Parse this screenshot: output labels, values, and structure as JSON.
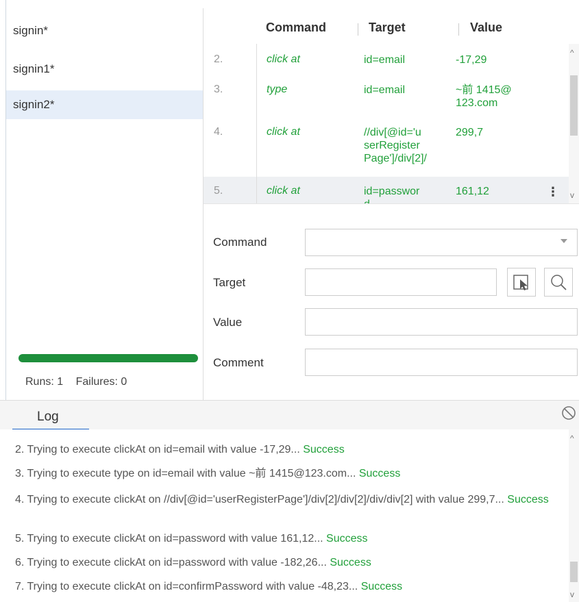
{
  "sidebar": {
    "suites": [
      {
        "label": "signin*"
      },
      {
        "label": "signin1*"
      },
      {
        "label": "signin2*"
      }
    ],
    "progress_fraction": 1.0,
    "runs_label": "Runs: 1",
    "failures_label": "Failures: 0"
  },
  "commands": {
    "headers": {
      "command": "Command",
      "target": "Target",
      "value": "Value"
    },
    "rows": [
      {
        "num": "2.",
        "command": "click at",
        "target": "id=email",
        "value": "-17,29"
      },
      {
        "num": "3.",
        "command": "type",
        "target": "id=email",
        "value": "~前 1415@\n123.com"
      },
      {
        "num": "4.",
        "command": "click at",
        "target": "//div[@id='u\nserRegister\nPage']/div[2]/",
        "value": "299,7"
      },
      {
        "num": "5.",
        "command": "click at",
        "target": "id=passwor\nd",
        "value": "161,12"
      }
    ]
  },
  "editor": {
    "command_label": "Command",
    "target_label": "Target",
    "value_label": "Value",
    "comment_label": "Comment",
    "command_value": "",
    "target_value": "",
    "value_value": "",
    "comment_value": ""
  },
  "log": {
    "tab_label": "Log",
    "lines": [
      {
        "num": "2.",
        "text": " Trying to execute clickAt on id=email with value -17,29... ",
        "status": "Success"
      },
      {
        "num": "3.",
        "text": " Trying to execute type on id=email with value ~前 1415@123.com... ",
        "status": "Success"
      },
      {
        "num": "4.",
        "text": " Trying to execute clickAt on //div[@id='userRegisterPage']/div[2]/div[2]/div/div[2] with value 299,7... ",
        "status": "Success"
      },
      {
        "num": "5.",
        "text": " Trying to execute clickAt on id=password with value 161,12... ",
        "status": "Success"
      },
      {
        "num": "6.",
        "text": " Trying to execute clickAt on id=password with value -182,26... ",
        "status": "Success"
      },
      {
        "num": "7.",
        "text": " Trying to execute clickAt on id=confirmPassword with value -48,23... ",
        "status": "Success"
      }
    ]
  },
  "colors": {
    "success": "#21a03a",
    "progress": "#1e8f3c",
    "selected_suite": "#e6eef9",
    "tab_accent": "#1d63c7"
  }
}
